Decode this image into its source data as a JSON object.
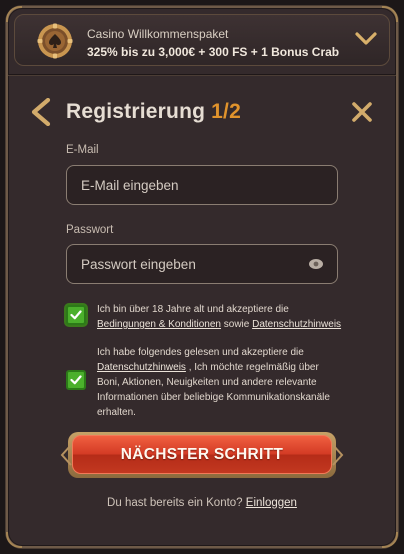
{
  "promo": {
    "title": "Casino Willkommenspaket",
    "subtitle": "325% bis zu 3,000€ + 300 FS + 1 Bonus Crab",
    "icon": "casino-chip-icon"
  },
  "heading": {
    "title": "Registrierung ",
    "step": "1/2",
    "back_icon": "chevron-left-icon",
    "close_icon": "close-icon"
  },
  "form": {
    "email_label": "E-Mail",
    "email_placeholder": "E-Mail eingeben",
    "email_value": "",
    "password_label": "Passwort",
    "password_placeholder": "Passwort eingeben",
    "password_value": ""
  },
  "consents": [
    {
      "checked": true,
      "text_before": "Ich bin über 18 Jahre alt und akzeptiere die ",
      "link1": "Bedingungen & Konditionen",
      "text_mid": " sowie ",
      "link2": "Datenschutzhinweis"
    },
    {
      "checked": true,
      "text_before": "Ich habe folgendes gelesen und akzeptiere die ",
      "link1": "Datenschutzhinweis",
      "text_after": " , Ich möchte regelmäßig über Boni, Aktionen, Neuigkeiten und andere relevante Informationen über beliebige Kommunikationskanäle erhalten."
    }
  ],
  "cta": {
    "label": "NÄCHSTER SCHRITT"
  },
  "footer": {
    "prompt": "Du hast bereits ein Konto? ",
    "login_link": "Einloggen"
  },
  "colors": {
    "accent_orange": "#e0932c",
    "checkbox_green": "#4bb02c",
    "cta_red": "#d43b25",
    "gold_trim": "#a48454"
  }
}
